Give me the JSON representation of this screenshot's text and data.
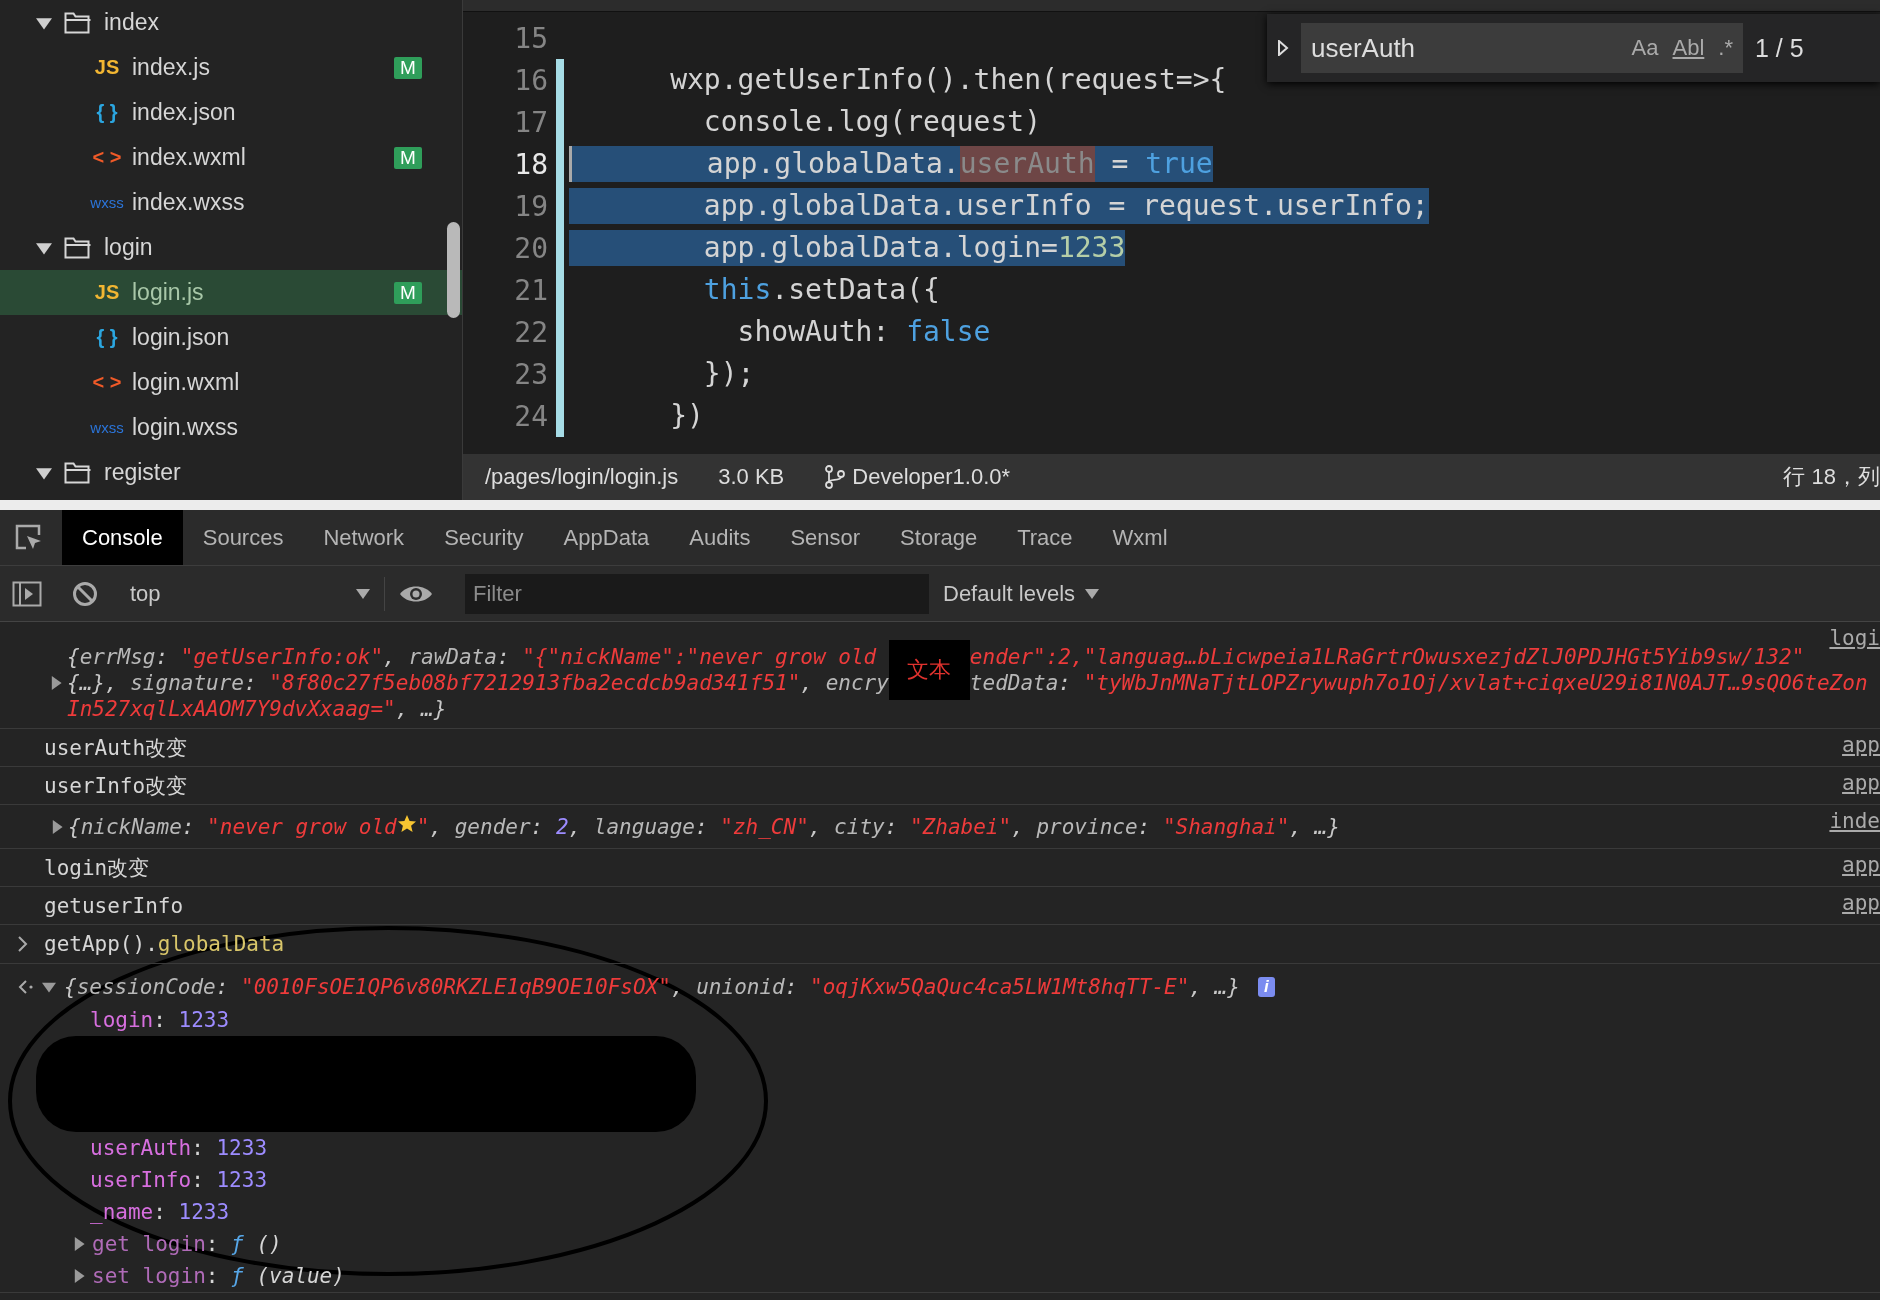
{
  "sidebar": {
    "tree": [
      {
        "name": "index",
        "expanded": true,
        "children": [
          {
            "name": "index.js",
            "kind": "js",
            "icon": "JS",
            "badge": "M",
            "selected": false
          },
          {
            "name": "index.json",
            "kind": "json",
            "icon": "{ }",
            "selected": false
          },
          {
            "name": "index.wxml",
            "kind": "wxml",
            "icon": "< >",
            "badge": "M",
            "selected": false
          },
          {
            "name": "index.wxss",
            "kind": "wxss",
            "icon": "wxss",
            "selected": false
          }
        ]
      },
      {
        "name": "login",
        "expanded": true,
        "children": [
          {
            "name": "login.js",
            "kind": "js",
            "icon": "JS",
            "badge": "M",
            "selected": true
          },
          {
            "name": "login.json",
            "kind": "json",
            "icon": "{ }",
            "selected": false
          },
          {
            "name": "login.wxml",
            "kind": "wxml",
            "icon": "< >",
            "selected": false
          },
          {
            "name": "login.wxss",
            "kind": "wxss",
            "icon": "wxss",
            "selected": false
          }
        ]
      },
      {
        "name": "register",
        "expanded": true
      }
    ]
  },
  "editor": {
    "lines": [
      {
        "number": "15",
        "changed": false,
        "current": false
      },
      {
        "number": "16",
        "changed": true,
        "current": false,
        "selected": false,
        "tokens": [
          {
            "t": "      wxp.getUserInfo().then(request=>{",
            "kind": "plain"
          }
        ]
      },
      {
        "number": "17",
        "changed": true,
        "current": false,
        "selected": false,
        "tokens": [
          {
            "t": "        console.log(request)",
            "kind": "plain"
          }
        ]
      },
      {
        "number": "18",
        "changed": true,
        "current": true,
        "selected": true,
        "tokens": [
          {
            "t": "        app.globalData.",
            "kind": "plain"
          },
          {
            "t": "userAuth",
            "kind": "match"
          },
          {
            "t": " = ",
            "kind": "plain"
          },
          {
            "t": "true",
            "kind": "kw"
          }
        ]
      },
      {
        "number": "19",
        "changed": true,
        "current": false,
        "selected": true,
        "tokens": [
          {
            "t": "        app.globalData.userInfo = request.userInfo;",
            "kind": "plain"
          }
        ]
      },
      {
        "number": "20",
        "changed": true,
        "current": false,
        "selected": true,
        "tokens": [
          {
            "t": "        app.globalData.login=",
            "kind": "plain"
          },
          {
            "t": "1233",
            "kind": "num"
          }
        ]
      },
      {
        "number": "21",
        "changed": true,
        "current": false,
        "selected": false,
        "tokens": [
          {
            "t": "        this",
            "kind": "kw"
          },
          {
            "t": ".setData({",
            "kind": "plain"
          }
        ]
      },
      {
        "number": "22",
        "changed": true,
        "current": false,
        "selected": false,
        "tokens": [
          {
            "t": "          showAuth: ",
            "kind": "plain"
          },
          {
            "t": "false",
            "kind": "kw"
          }
        ]
      },
      {
        "number": "23",
        "changed": true,
        "current": false,
        "selected": false,
        "tokens": [
          {
            "t": "        });",
            "kind": "plain"
          }
        ]
      },
      {
        "number": "24",
        "changed": true,
        "current": false,
        "selected": false,
        "tokens": [
          {
            "t": "      })",
            "kind": "plain"
          }
        ]
      }
    ],
    "find": {
      "query": "userAuth",
      "options": [
        "Aa",
        "Abl",
        ".*"
      ],
      "count": "1 / 5"
    },
    "status_bar": {
      "path": "/pages/login/login.js",
      "size": "3.0 KB",
      "branch": "Developer1.0.0*",
      "position": "行 18，列"
    }
  },
  "devtools": {
    "tabs": [
      {
        "label": "Console",
        "selected": true
      },
      {
        "label": "Sources",
        "selected": false
      },
      {
        "label": "Network",
        "selected": false
      },
      {
        "label": "Security",
        "selected": false
      },
      {
        "label": "AppData",
        "selected": false
      },
      {
        "label": "Audits",
        "selected": false
      },
      {
        "label": "Sensor",
        "selected": false
      },
      {
        "label": "Storage",
        "selected": false
      },
      {
        "label": "Trace",
        "selected": false
      },
      {
        "label": "Wxml",
        "selected": false
      }
    ],
    "toolbar": {
      "context": "top",
      "filter_placeholder": "Filter",
      "levels": "Default levels"
    },
    "console": [
      {
        "kind": "multiline",
        "source": "logi",
        "expanded": false,
        "overlay": "文本",
        "left1": [
          {
            "t": "{",
            "kind": "p"
          },
          {
            "t": "errMsg",
            "kind": "key"
          },
          {
            "t": ": ",
            "kind": "p"
          },
          {
            "t": "\"getUserInfo:ok\"",
            "kind": "str"
          },
          {
            "t": ", ",
            "kind": "p"
          },
          {
            "t": "rawData",
            "kind": "key"
          },
          {
            "t": ": ",
            "kind": "p"
          },
          {
            "t": "\"{\"nickName\":\"never grow old",
            "kind": "str"
          }
        ],
        "right1": [
          {
            "t": "ender\":2,\"languag…bLicwpeia1LRaGrtrOwusxezjdZlJ0PDJHGt5Yib9sw/132\"",
            "kind": "str"
          }
        ],
        "left2": [
          {
            "t": "{…}, ",
            "kind": "p"
          },
          {
            "t": "signature",
            "kind": "key"
          },
          {
            "t": ": ",
            "kind": "p"
          },
          {
            "t": "\"8f80c27f5eb08bf7212913fba2ecdcb9ad341f51\"",
            "kind": "str"
          },
          {
            "t": ", ",
            "kind": "p"
          },
          {
            "t": "encry",
            "kind": "key"
          }
        ],
        "right2": [
          {
            "t": "tedData",
            "kind": "key"
          },
          {
            "t": ": ",
            "kind": "p"
          },
          {
            "t": "\"tyWbJnMNaTjtLOPZrywuph7o1Oj/xvlat+ciqxeU29i81N0AJT…9sQO6teZon",
            "kind": "str"
          }
        ],
        "line3": [
          {
            "t": "In527xqlLxAAOM7Y9dvXxaag=\"",
            "kind": "str"
          },
          {
            "t": ", …}",
            "kind": "p"
          }
        ]
      },
      {
        "kind": "log",
        "text": "userAuth改变",
        "source": "app"
      },
      {
        "kind": "log",
        "text": "userInfo改变",
        "source": "app"
      },
      {
        "kind": "object",
        "source": "inde",
        "expanded": false,
        "tokens": [
          {
            "t": "{",
            "kind": "p"
          },
          {
            "t": "nickName",
            "kind": "key"
          },
          {
            "t": ": ",
            "kind": "p"
          },
          {
            "t": "\"never grow old",
            "kind": "str"
          },
          {
            "kind": "star"
          },
          {
            "t": "\"",
            "kind": "str"
          },
          {
            "t": ", ",
            "kind": "p"
          },
          {
            "t": "gender",
            "kind": "key"
          },
          {
            "t": ": ",
            "kind": "p"
          },
          {
            "t": "2",
            "kind": "num"
          },
          {
            "t": ", ",
            "kind": "p"
          },
          {
            "t": "language",
            "kind": "key"
          },
          {
            "t": ": ",
            "kind": "p"
          },
          {
            "t": "\"zh_CN\"",
            "kind": "str"
          },
          {
            "t": ", ",
            "kind": "p"
          },
          {
            "t": "city",
            "kind": "key"
          },
          {
            "t": ": ",
            "kind": "p"
          },
          {
            "t": "\"Zhabei\"",
            "kind": "str"
          },
          {
            "t": ", ",
            "kind": "p"
          },
          {
            "t": "province",
            "kind": "key"
          },
          {
            "t": ": ",
            "kind": "p"
          },
          {
            "t": "\"Shanghai\"",
            "kind": "str"
          },
          {
            "t": ", …}",
            "kind": "p"
          }
        ]
      },
      {
        "kind": "log",
        "text": "login改变",
        "source": "app"
      },
      {
        "kind": "log",
        "text": "getuserInfo",
        "source": "app"
      },
      {
        "kind": "input",
        "tokens": [
          {
            "t": "getApp().",
            "kind": "plain"
          },
          {
            "t": "globalData",
            "kind": "prop"
          }
        ]
      },
      {
        "kind": "result",
        "expanded": true,
        "badge": "i",
        "tokens": [
          {
            "t": "{",
            "kind": "p"
          },
          {
            "t": "sessionCode",
            "kind": "key"
          },
          {
            "t": ": ",
            "kind": "p"
          },
          {
            "t": "\"0010FsOE1QP6v80RKZLE1qB9OE10FsOX\"",
            "kind": "str"
          },
          {
            "t": ", ",
            "kind": "p"
          },
          {
            "t": "unionid",
            "kind": "key"
          },
          {
            "t": ": ",
            "kind": "p"
          },
          {
            "t": "\"oqjKxw5QaQuc4ca5LW1Mt8hqTT-E\"",
            "kind": "str"
          },
          {
            "t": ", …}",
            "kind": "p"
          }
        ],
        "properties": [
          {
            "kind": "value",
            "tokens": [
              {
                "t": "login",
                "kind": "pk"
              },
              {
                "t": ": ",
                "kind": "plain"
              },
              {
                "t": "1233",
                "kind": "pv"
              }
            ]
          },
          {
            "kind": "redacted"
          },
          {
            "kind": "value",
            "tokens": [
              {
                "t": "userAuth",
                "kind": "pk"
              },
              {
                "t": ": ",
                "kind": "plain"
              },
              {
                "t": "1233",
                "kind": "pv"
              }
            ]
          },
          {
            "kind": "value",
            "tokens": [
              {
                "t": "userInfo",
                "kind": "pk"
              },
              {
                "t": ": ",
                "kind": "plain"
              },
              {
                "t": "1233",
                "kind": "pv"
              }
            ]
          },
          {
            "kind": "value",
            "tokens": [
              {
                "t": "_name",
                "kind": "pk"
              },
              {
                "t": ": ",
                "kind": "plain"
              },
              {
                "t": "1233",
                "kind": "pv"
              }
            ]
          },
          {
            "kind": "accessor",
            "expanded": false,
            "tokens": [
              {
                "t": "get login",
                "kind": "ak"
              },
              {
                "t": ": ",
                "kind": "plain"
              },
              {
                "t": "ƒ",
                "kind": "fn"
              },
              {
                "t": " ()",
                "kind": "args"
              }
            ]
          },
          {
            "kind": "accessor",
            "expanded": false,
            "tokens": [
              {
                "t": "set login",
                "kind": "ak"
              },
              {
                "t": ": ",
                "kind": "plain"
              },
              {
                "t": "ƒ",
                "kind": "fn"
              },
              {
                "t": " (value)",
                "kind": "args"
              }
            ]
          }
        ]
      }
    ]
  }
}
